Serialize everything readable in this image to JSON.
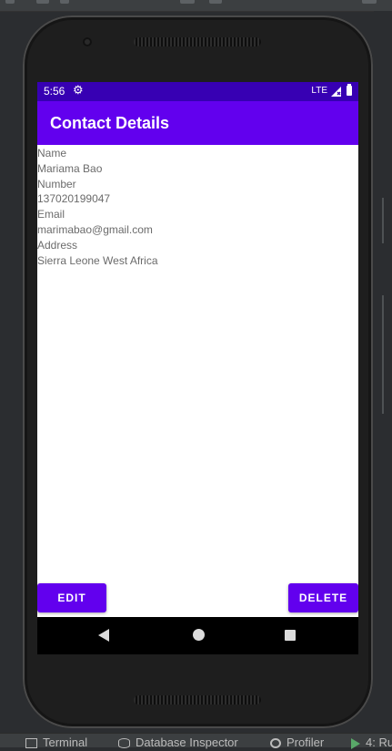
{
  "statusbar": {
    "time": "5:56",
    "network": "LTE",
    "settings_icon": "gear-icon",
    "signal_icon": "signal-icon",
    "battery_icon": "battery-icon"
  },
  "appbar": {
    "title": "Contact Details"
  },
  "contact": {
    "name_label": "Name",
    "name": "Mariama Bao",
    "number_label": "Number",
    "number": "137020199047",
    "email_label": "Email",
    "email": "marimabao@gmail.com",
    "address_label": "Address",
    "address": "Sierra Leone West Africa"
  },
  "buttons": {
    "edit": "EDIT",
    "delete": "DELETE"
  },
  "navbar": {
    "back_icon": "back-icon",
    "home_icon": "home-icon",
    "recents_icon": "recents-icon"
  },
  "ide_bottom": {
    "terminal": "Terminal",
    "database_inspector": "Database Inspector",
    "profiler": "Profiler",
    "run": "4: Ru"
  },
  "colors": {
    "primary": "#6200ee",
    "primary_dark": "#3700b3",
    "ide_background": "#2b2d30"
  }
}
